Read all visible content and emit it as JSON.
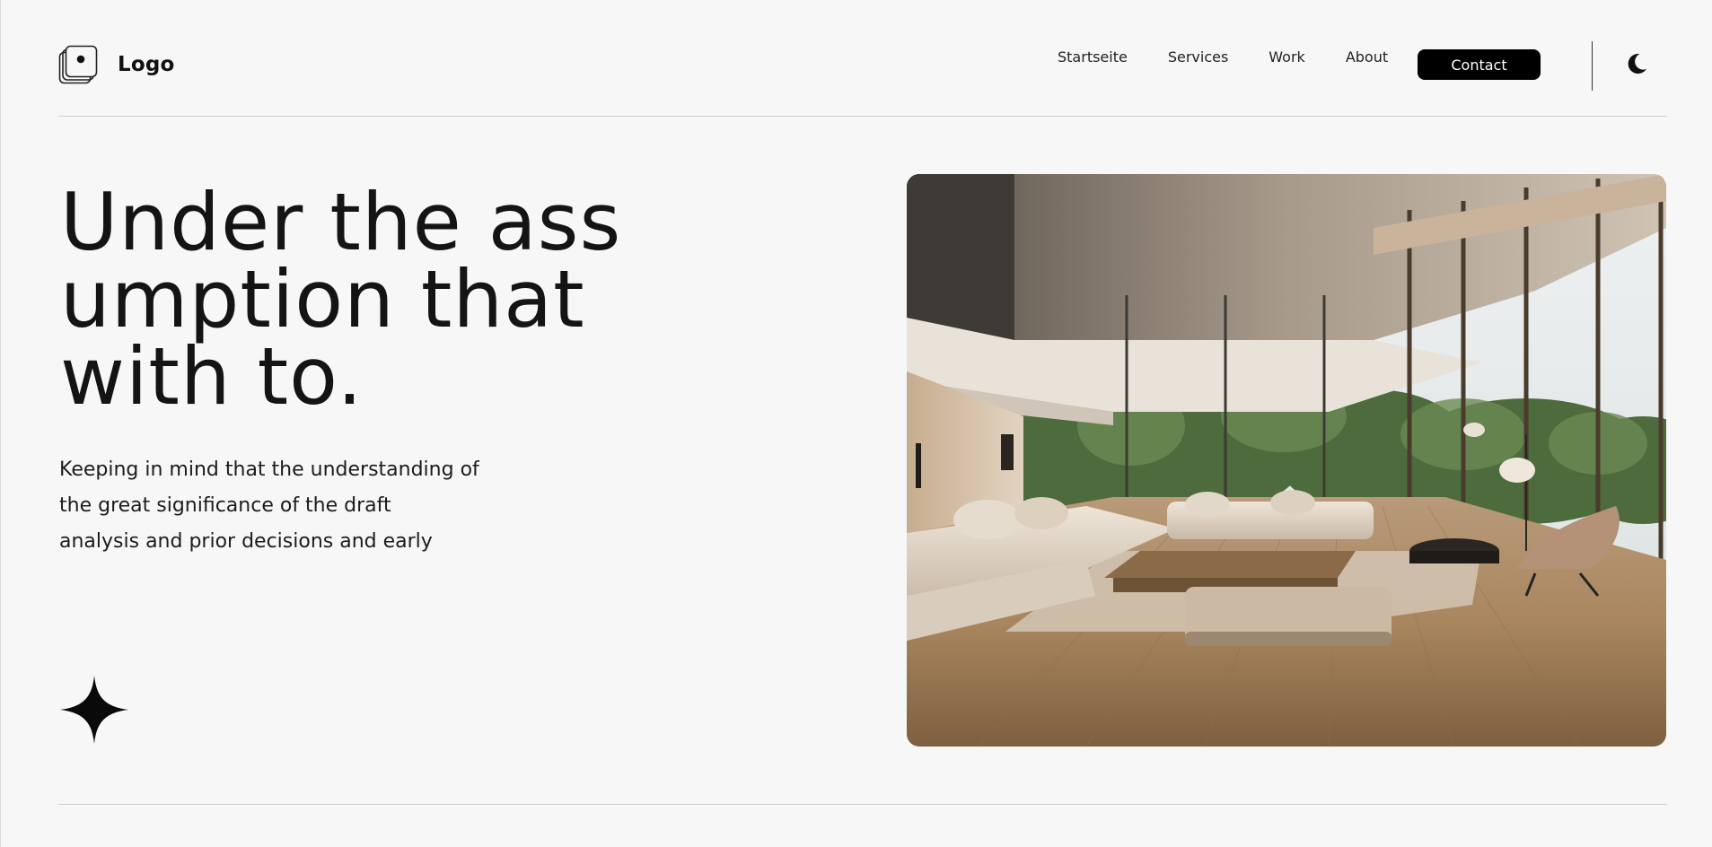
{
  "header": {
    "logo_text": "Logo",
    "nav": [
      "Startseite",
      "Services",
      "Work",
      "About"
    ],
    "contact_label": "Contact"
  },
  "hero": {
    "title_lines": [
      "Under the ass",
      "umption that",
      "with to."
    ],
    "body_lines": [
      "Keeping in mind that the understanding of",
      "the great significance of the draft",
      "analysis and prior decisions and early"
    ]
  },
  "colors": {
    "background": "#f7f7f7",
    "text": "#111111",
    "button_bg": "#000000",
    "button_text": "#ffffff",
    "rule": "#cfcfcf"
  },
  "icons": {
    "logo": "stacked-squares-icon",
    "theme": "moon-icon",
    "decor": "four-point-star-icon"
  }
}
